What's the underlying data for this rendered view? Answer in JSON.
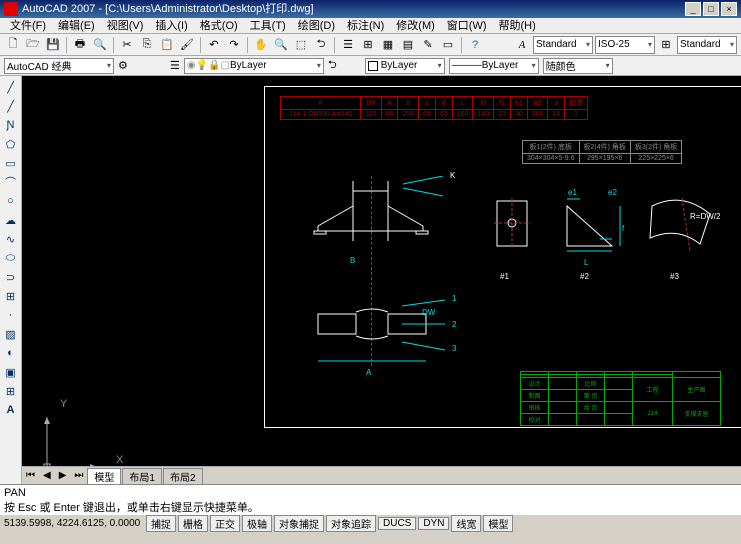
{
  "title": "AutoCAD 2007 - [C:\\Users\\Administrator\\Desktop\\打印.dwg]",
  "menus": [
    "文件(F)",
    "编辑(E)",
    "视图(V)",
    "插入(I)",
    "格式(O)",
    "工具(T)",
    "绘图(D)",
    "标注(N)",
    "修改(M)",
    "窗口(W)",
    "帮助(H)"
  ],
  "workspace": "AutoCAD 经典",
  "style1": "Standard",
  "style2": "ISO-25",
  "style3": "Standard",
  "layer": "ByLayer",
  "ltype": "ByLayer",
  "color_sel": "随颜色",
  "cmd_line1": "PAN",
  "cmd_line2": "按 Esc 或 Enter 键退出，或单击右键显示快捷菜单。",
  "coords": "5139.5998, 4224.6125, 0.0000",
  "status_btns": [
    "捕捉",
    "栅格",
    "正交",
    "极轴",
    "对象捕捉",
    "对象追踪",
    "DUCS",
    "DYN",
    "线宽",
    "模型"
  ],
  "model_tabs": [
    "模型",
    "布局1",
    "布局2"
  ],
  "axis": {
    "x": "X",
    "y": "Y"
  },
  "table1_header": [
    "#",
    "D#",
    "A",
    "b",
    "c",
    "d",
    "L",
    "M",
    "f1",
    "e1",
    "e2",
    "a",
    "取重"
  ],
  "table1_row": [
    "J14-1 DN500 A=045",
    "325",
    "66",
    "256",
    "66",
    "63",
    "160",
    "160",
    "23",
    "30",
    "205",
    "18",
    "2"
  ],
  "table2_h": [
    "板1(2件) 底板",
    "板2(4件) 角板",
    "板3(2件) 角板"
  ],
  "table2_r": [
    "304×304×5-9.6",
    "295×195×6",
    "225×225×6"
  ],
  "labels": {
    "k": "K",
    "b": "B",
    "a": "A",
    "dw": "DW",
    "n1": "#1",
    "n2": "#2",
    "n3": "#3",
    "rd": "R=DW/2",
    "e1": "e1",
    "e2": "e2",
    "f": "f",
    "L": "L",
    "num1": "1",
    "num2": "2",
    "num3": "3"
  },
  "title_block": {
    "proj": "工程",
    "subj": "生产图",
    "code": "J14",
    "name": "支撑支座",
    "cell1": "设计",
    "cell2": "制图",
    "cell3": "审核",
    "cell4": "校对",
    "cell5": "比例",
    "cell6": "第 页",
    "cell7": "共 页"
  }
}
